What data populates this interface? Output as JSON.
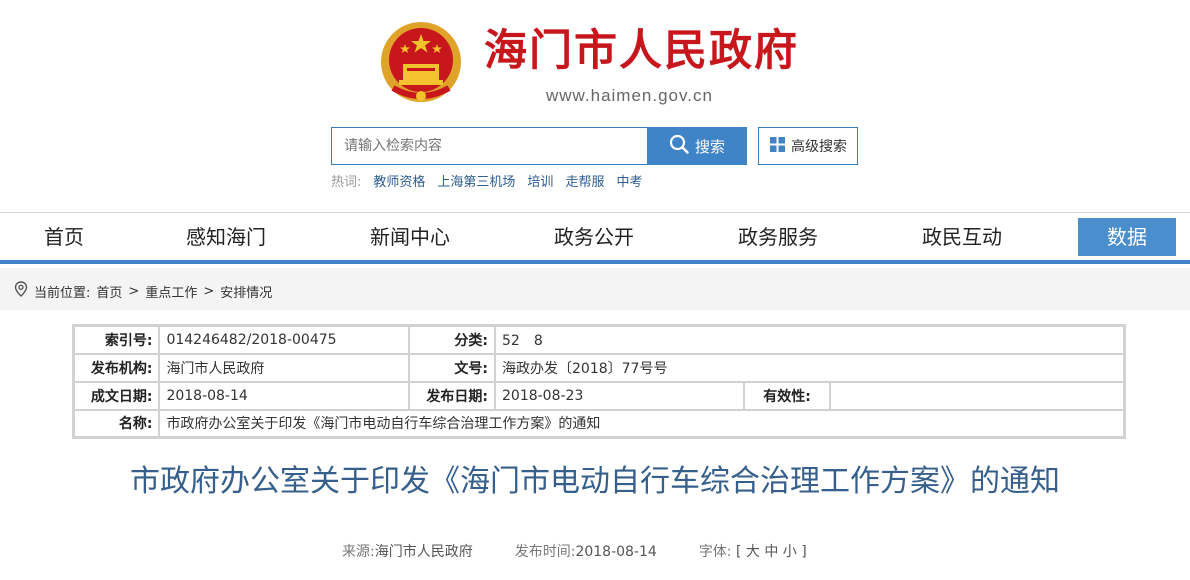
{
  "header": {
    "site_title": "海门市人民政府",
    "site_url": "www.haimen.gov.cn"
  },
  "search": {
    "placeholder": "请输入检索内容",
    "button_label": "搜索",
    "advanced_label": "高级搜索",
    "hot_label": "热词:",
    "hot_words": [
      "教师资格",
      "上海第三机场",
      "培训",
      "走帮服",
      "中考"
    ]
  },
  "nav": {
    "items": [
      "首页",
      "感知海门",
      "新闻中心",
      "政务公开",
      "政务服务",
      "政民互动",
      "数据"
    ],
    "active": "数据"
  },
  "breadcrumb": {
    "label": "当前位置:",
    "items": [
      "首页",
      "重点工作",
      "安排情况"
    ],
    "separator": ">"
  },
  "meta": {
    "index_label": "索引号:",
    "index_value": "014246482/2018-00475",
    "category_label": "分类:",
    "category_value": "52　8",
    "org_label": "发布机构:",
    "org_value": "海门市人民政府",
    "docno_label": "文号:",
    "docno_value": "海政办发〔2018〕77号号",
    "created_label": "成文日期:",
    "created_value": "2018-08-14",
    "published_label": "发布日期:",
    "published_value": "2018-08-23",
    "validity_label": "有效性:",
    "validity_value": "",
    "name_label": "名称:",
    "name_value": "市政府办公室关于印发《海门市电动自行车综合治理工作方案》的通知"
  },
  "article": {
    "title": "市政府办公室关于印发《海门市电动自行车综合治理工作方案》的通知",
    "source_label": "来源:",
    "source_value": "海门市人民政府",
    "time_label": "发布时间:",
    "time_value": "2018-08-14",
    "font_label": "字体:",
    "font_sizes": "[ 大 中 小 ]"
  },
  "colors": {
    "brand_red": "#c8161d",
    "accent_blue": "#3f84c7",
    "title_blue": "#365f8c"
  }
}
